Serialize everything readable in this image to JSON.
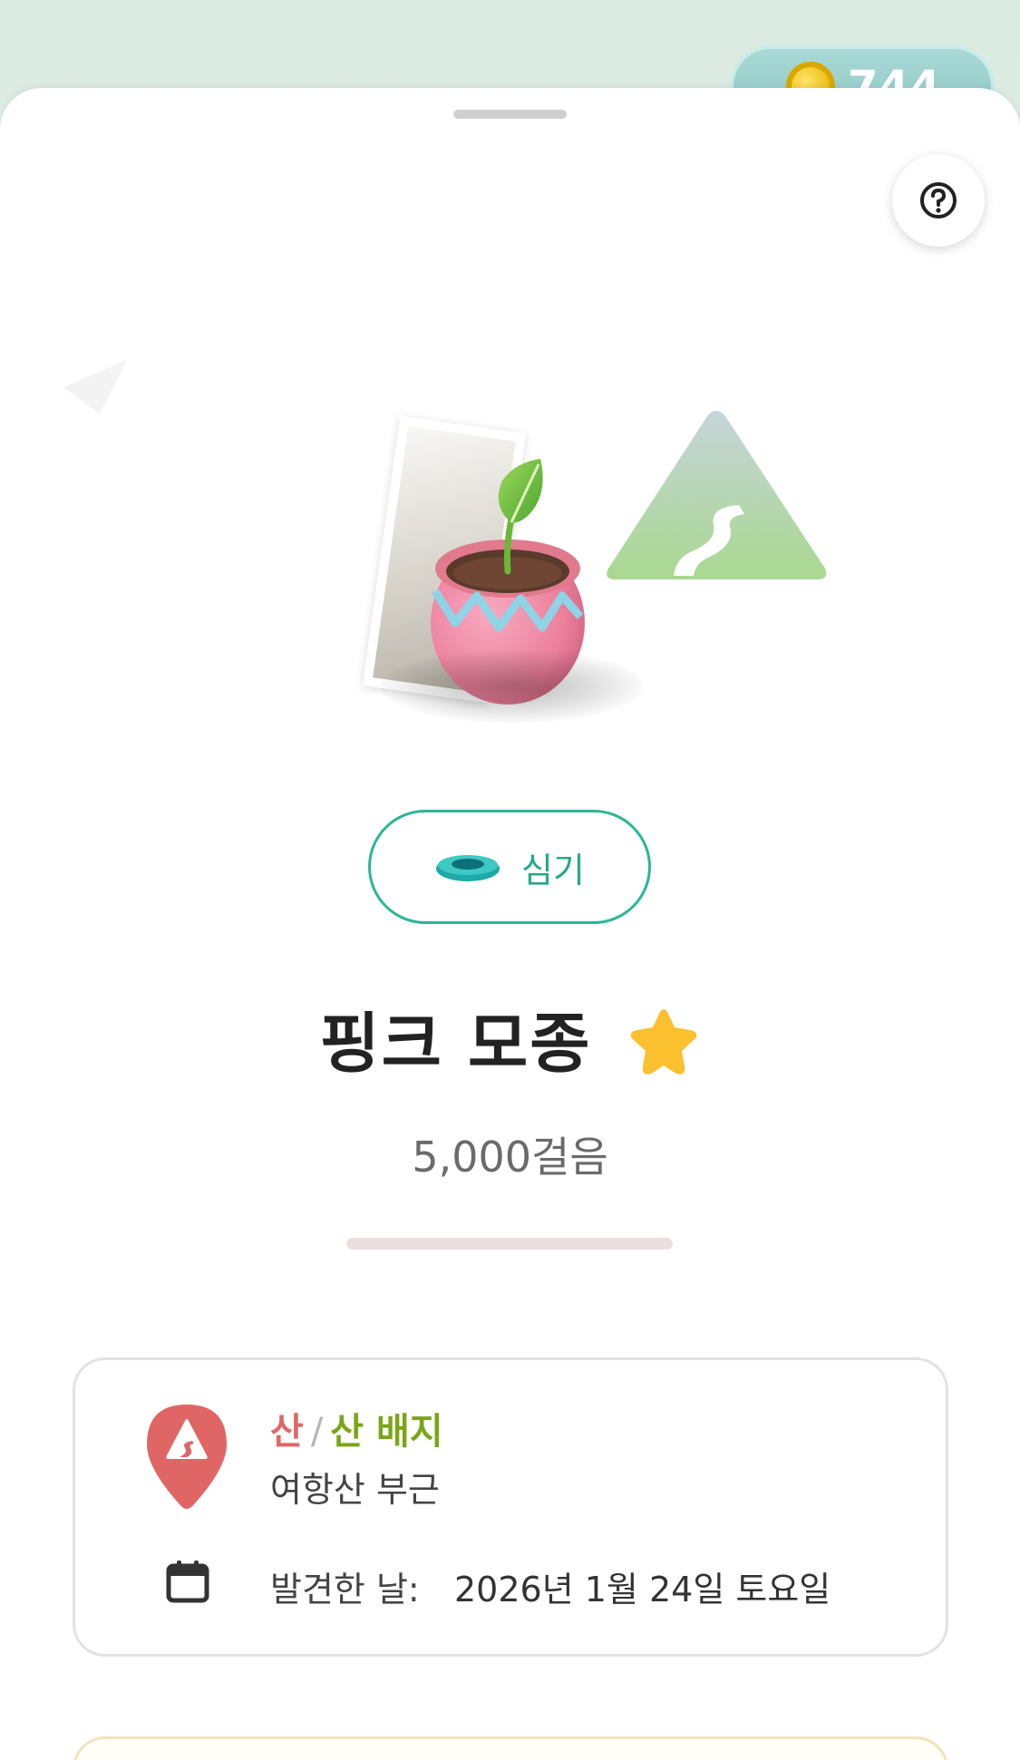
{
  "wallet": {
    "coins": "744",
    "icon": "coin-icon"
  },
  "help": {
    "icon": "help-icon"
  },
  "item": {
    "title": "핑크 모종",
    "steps": "5,000걸음",
    "progress_fraction": 0.0,
    "favorite_icon": "star-icon",
    "plant_button_label": "심기"
  },
  "info": {
    "category": "산",
    "separator": "/",
    "badge": "산 배지",
    "location": "여항산 부근",
    "found_label": "발견한 날:",
    "found_date": "2026년 1월 24일 토요일"
  },
  "colors": {
    "accent_teal": "#2bb797",
    "mountain_red": "#e06666",
    "badge_green": "#7aa617",
    "star_yellow": "#fbc02d",
    "pot_pink": "#f08aa6"
  }
}
